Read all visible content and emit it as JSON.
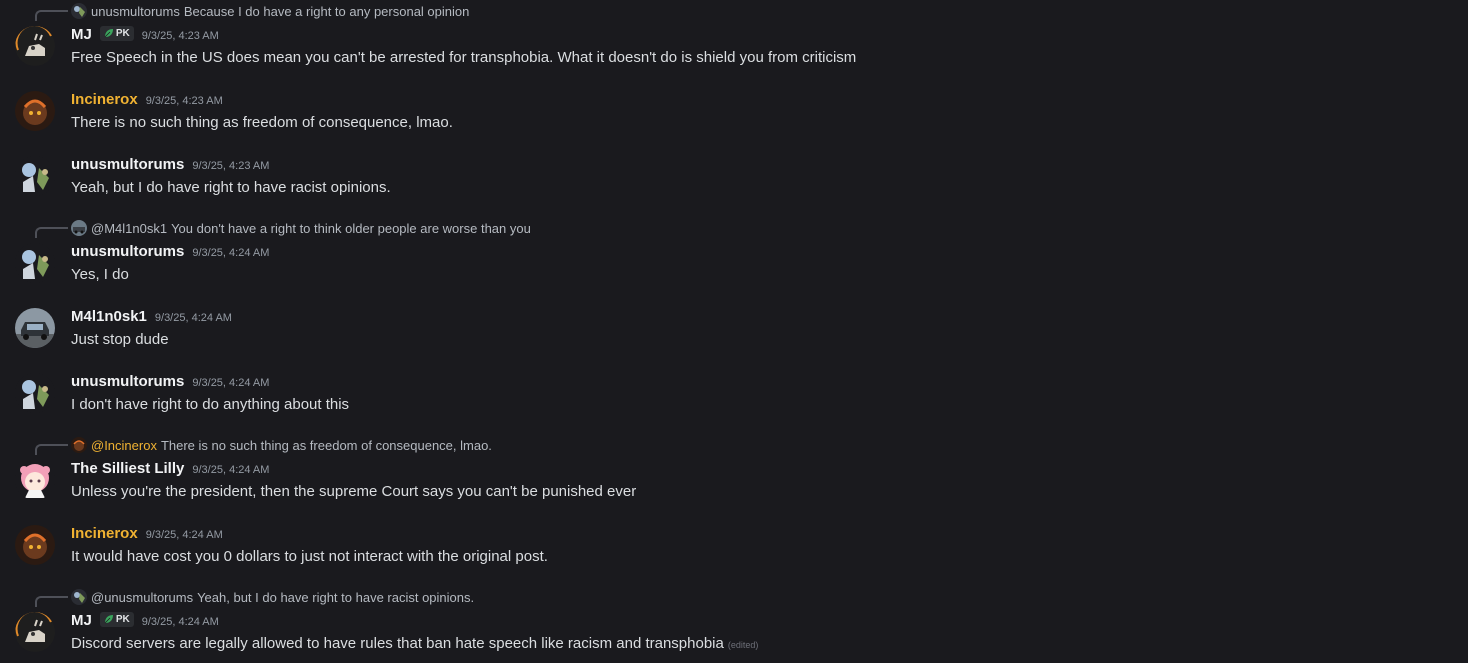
{
  "messages": [
    {
      "reply": {
        "name": "unusmultorums",
        "text": "Because I do have a right to any personal opinion"
      },
      "name": "MJ",
      "pk": "PK",
      "timestamp": "9/3/25, 4:23 AM",
      "content": "Free Speech in the US does mean you can't be arrested for transphobia. What it doesn't do is shield you from criticism"
    },
    {
      "name": "Incinerox",
      "timestamp": "9/3/25, 4:23 AM",
      "content": "There is no such thing as freedom of consequence, lmao."
    },
    {
      "name": "unusmultorums",
      "timestamp": "9/3/25, 4:23 AM",
      "content": "Yeah, but I do have right to have racist opinions."
    },
    {
      "reply": {
        "name": "@M4l1n0sk1",
        "text": "You don't have a right to think older people are worse than you"
      },
      "name": "unusmultorums",
      "timestamp": "9/3/25, 4:24 AM",
      "content": "Yes, I do"
    },
    {
      "name": "M4l1n0sk1",
      "timestamp": "9/3/25, 4:24 AM",
      "content": "Just stop dude"
    },
    {
      "name": "unusmultorums",
      "timestamp": "9/3/25, 4:24 AM",
      "content": "I don't have right to do anything about this"
    },
    {
      "reply": {
        "name": "@Incinerox",
        "text": "There is no such thing as freedom of consequence, lmao."
      },
      "name": "The Silliest Lilly",
      "timestamp": "9/3/25, 4:24 AM",
      "content": "Unless you're the president, then the supreme Court says you can't be punished ever"
    },
    {
      "name": "Incinerox",
      "timestamp": "9/3/25, 4:24 AM",
      "content": "It would have cost you 0 dollars to just not interact with the original post."
    },
    {
      "reply": {
        "name": "@unusmultorums",
        "text": "Yeah, but I do have right to have racist opinions."
      },
      "name": "MJ",
      "pk": "PK",
      "timestamp": "9/3/25, 4:24 AM",
      "content": "Discord servers are legally allowed to have rules that ban hate speech like racism and transphobia",
      "edited": "(edited)"
    }
  ],
  "colors": {
    "background": "#1a1a1e",
    "username": "#f2f3f5",
    "role_gold": "#f0b232",
    "text": "#dbdee1",
    "muted": "#949ba4"
  }
}
